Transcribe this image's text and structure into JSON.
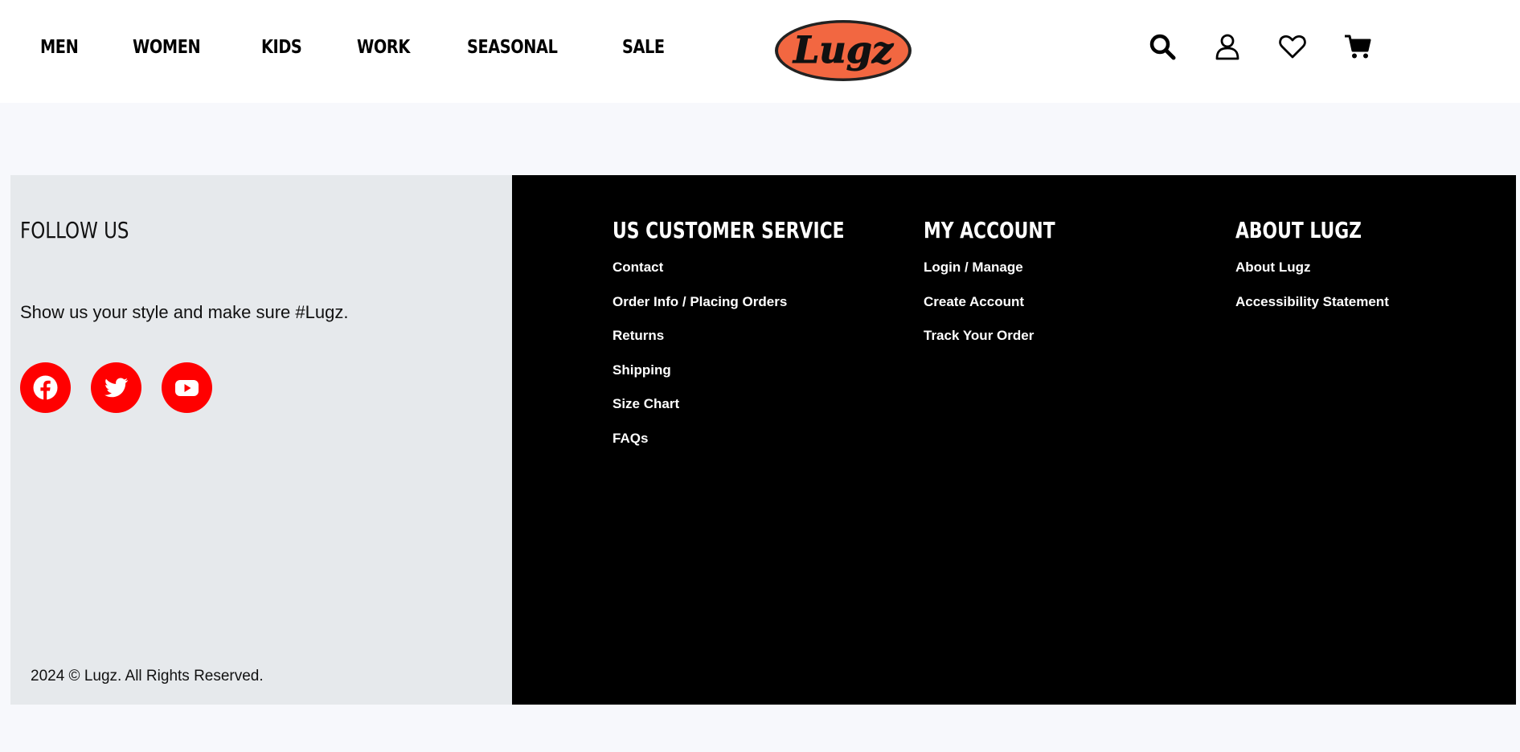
{
  "nav": {
    "items": [
      {
        "label": "MEN"
      },
      {
        "label": "WOMEN"
      },
      {
        "label": "KIDS"
      },
      {
        "label": "WORK"
      },
      {
        "label": "SEASONAL"
      },
      {
        "label": "SALE"
      }
    ]
  },
  "logo": {
    "text": "Lugz",
    "colors": {
      "fill": "#f26741",
      "outline": "#222222"
    }
  },
  "header_icons": [
    "search-icon",
    "account-icon",
    "wishlist-heart-icon",
    "cart-icon"
  ],
  "follow": {
    "title": "FOLLOW US",
    "text": "Show us your style and make sure #Lugz.",
    "socials": [
      "facebook-icon",
      "twitter-icon",
      "youtube-icon"
    ],
    "social_color": "#ff0000"
  },
  "footer": {
    "columns": [
      {
        "title": "US CUSTOMER SERVICE",
        "links": [
          "Contact",
          "Order Info / Placing Orders",
          "Returns",
          "Shipping",
          "Size Chart",
          "FAQs"
        ]
      },
      {
        "title": "MY ACCOUNT",
        "links": [
          "Login / Manage",
          "Create Account",
          "Track Your Order"
        ]
      },
      {
        "title": "ABOUT LUGZ",
        "links": [
          "About Lugz",
          "Accessibility Statement"
        ]
      }
    ],
    "copyright": "2024 © Lugz. All Rights Reserved."
  }
}
